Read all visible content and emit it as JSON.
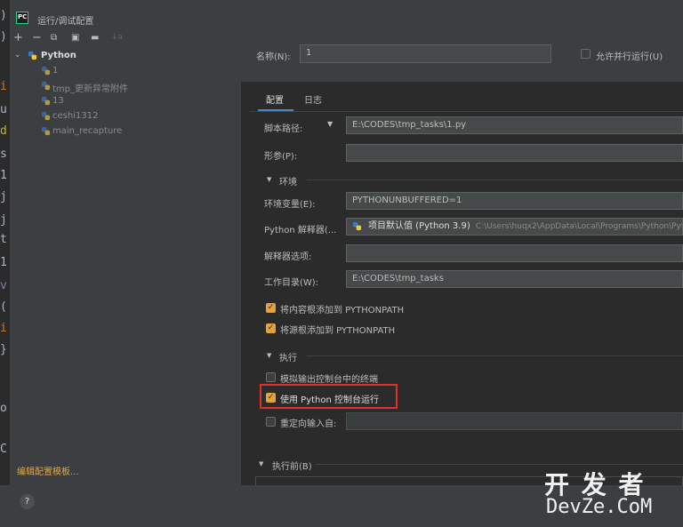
{
  "window": {
    "title": "运行/调试配置",
    "app_badge": "PC"
  },
  "toolbar": {
    "add": "+",
    "remove": "−",
    "copy": "⧉",
    "save": "▣",
    "folder": "▬",
    "sort": "↓a"
  },
  "tree": {
    "root": "Python",
    "items": [
      "1",
      "tmp_更新异常附件",
      "13",
      "ceshi1312",
      "main_recapture"
    ]
  },
  "left_footer": {
    "edit_templates": "编辑配置模板...",
    "help": "?"
  },
  "code_fragments": [
    {
      "text": ")",
      "color": "#a9b7c6"
    },
    {
      "text": ")",
      "color": "#a9b7c6"
    },
    {
      "text": "i",
      "color": "#cc7832"
    },
    {
      "text": "u",
      "color": "#a9b7c6"
    },
    {
      "text": "d",
      "color": "#bbb529"
    },
    {
      "text": "s",
      "color": "#a9b7c6"
    },
    {
      "text": "1",
      "color": "#a9b7c6"
    },
    {
      "text": "j",
      "color": "#a9b7c6"
    },
    {
      "text": "j",
      "color": "#a9b7c6"
    },
    {
      "text": "t",
      "color": "#a9b7c6"
    },
    {
      "text": "1",
      "color": "#a9b7c6"
    },
    {
      "text": "v",
      "color": "#9876aa"
    },
    {
      "text": "(",
      "color": "#a9b7c6"
    },
    {
      "text": "i",
      "color": "#cc7832"
    },
    {
      "text": "}",
      "color": "#a9b7c6"
    },
    {
      "text": "o",
      "color": "#a9b7c6"
    },
    {
      "text": "C",
      "color": "#a9b7c6"
    }
  ],
  "form": {
    "name_label": "名称(N):",
    "name_value": "1",
    "allow_parallel": "允许并行运行(U)",
    "tabs": [
      "配置",
      "日志"
    ],
    "script_path_label": "脚本路径:",
    "script_path_value": "E:\\CODES\\tmp_tasks\\1.py",
    "params_label": "形参(P):",
    "env_section": "环境",
    "env_vars_label": "环境变量(E):",
    "env_vars_value": "PYTHONUNBUFFERED=1",
    "interpreter_label": "Python 解释器(...",
    "interpreter_value": "项目默认值 (Python 3.9)",
    "interpreter_path": "C:\\Users\\huqx2\\AppData\\Local\\Programs\\Python\\Pyt",
    "interp_options_label": "解释器选项:",
    "workdir_label": "工作目录(W):",
    "workdir_value": "E:\\CODES\\tmp_tasks",
    "add_content_roots": "将内容根添加到 PYTHONPATH",
    "add_source_roots": "将源根添加到 PYTHONPATH",
    "exec_section": "执行",
    "emulate_terminal": "模拟输出控制台中的终端",
    "use_python_console": "使用 Python 控制台运行",
    "redirect_input": "重定向输入自:",
    "before_launch": "执行前(B)"
  },
  "watermark": {
    "top": "开 发 者",
    "bottom": "DevZe.CoM"
  },
  "colors": {
    "accent_check": "#e3a23a",
    "highlight_box": "#e0302b",
    "tab_underline": "#4a88c7"
  }
}
